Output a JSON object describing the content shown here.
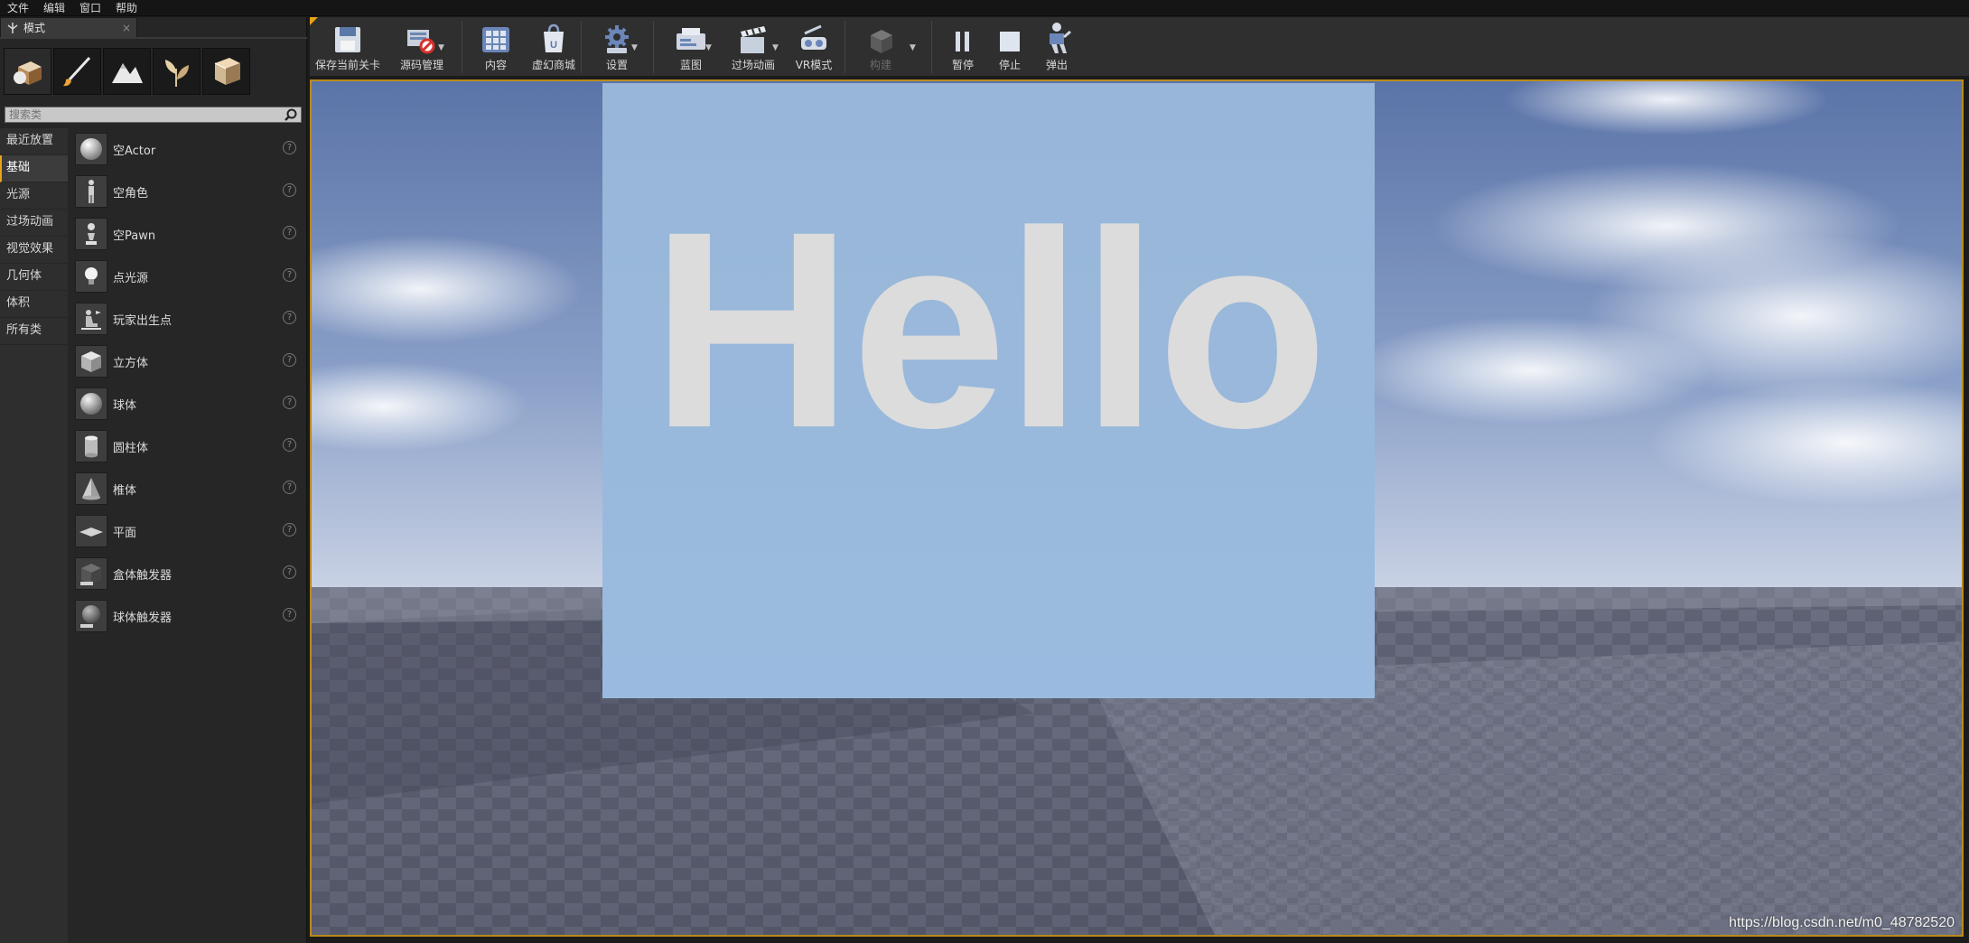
{
  "menu": [
    "文件",
    "编辑",
    "窗口",
    "帮助"
  ],
  "modes_panel": {
    "tab_title": "模式",
    "mode_icons": [
      "place-mode-icon",
      "paint-mode-icon",
      "landscape-mode-icon",
      "foliage-mode-icon",
      "geometry-mode-icon"
    ],
    "search_placeholder": "搜索类",
    "categories": [
      "最近放置",
      "基础",
      "光源",
      "过场动画",
      "视觉效果",
      "几何体",
      "体积",
      "所有类"
    ],
    "active_category": "基础",
    "actors": [
      {
        "label": "空Actor",
        "icon": "sphere-icon"
      },
      {
        "label": "空角色",
        "icon": "character-icon"
      },
      {
        "label": "空Pawn",
        "icon": "pawn-icon"
      },
      {
        "label": "点光源",
        "icon": "lightbulb-icon"
      },
      {
        "label": "玩家出生点",
        "icon": "player-start-icon"
      },
      {
        "label": "立方体",
        "icon": "cube-icon"
      },
      {
        "label": "球体",
        "icon": "sphere-icon"
      },
      {
        "label": "圆柱体",
        "icon": "cylinder-icon"
      },
      {
        "label": "椎体",
        "icon": "cone-icon"
      },
      {
        "label": "平面",
        "icon": "plane-icon"
      },
      {
        "label": "盒体触发器",
        "icon": "box-trigger-icon"
      },
      {
        "label": "球体触发器",
        "icon": "sphere-trigger-icon"
      }
    ]
  },
  "toolbar": {
    "save": "保存当前关卡",
    "source_control": "源码管理",
    "content": "内容",
    "marketplace": "虚幻商城",
    "settings": "设置",
    "blueprints": "蓝图",
    "cinematics": "过场动画",
    "vr_mode": "VR模式",
    "build": "构建",
    "pause": "暂停",
    "stop": "停止",
    "eject": "弹出"
  },
  "viewport": {
    "widget_text": "Hello",
    "watermark": "https://blog.csdn.net/m0_48782520"
  },
  "colors": {
    "accent": "#e8a317",
    "panel_bg": "#262626",
    "widget_bg": "#98b6d8",
    "widget_text": "#dcdcdc"
  }
}
